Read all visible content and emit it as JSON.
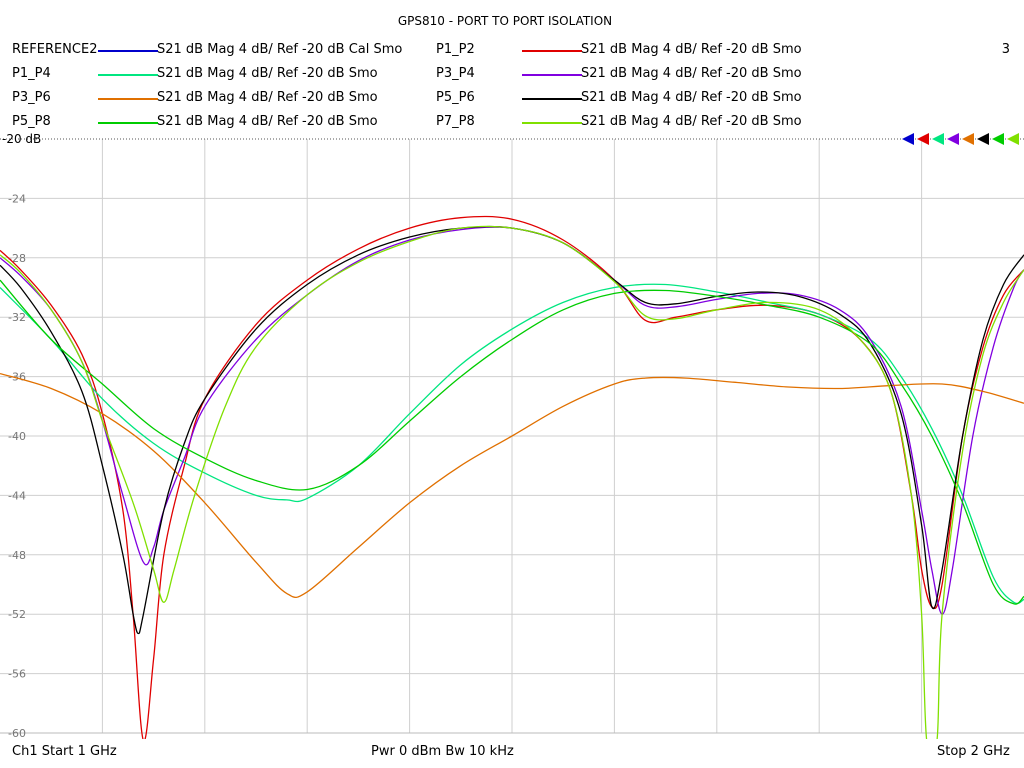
{
  "chart_data": {
    "type": "line",
    "title": "GPS810 - PORT TO PORT ISOLATION",
    "channel_number": "3",
    "reference_label": "-20 dB",
    "yticks": [
      "-24",
      "-28",
      "-32",
      "-36",
      "-40",
      "-44",
      "-48",
      "-52",
      "-56",
      "-60"
    ],
    "xlim": [
      1,
      2
    ],
    "ylim": [
      -60,
      -20
    ],
    "x_divisions": 10,
    "grid": true,
    "legend_position": "top",
    "series": [
      {
        "name": "REFERENCE2",
        "desc": "S21  dB Mag  4 dB/ Ref -20 dB  Cal Smo",
        "color": "#0000cc",
        "points": []
      },
      {
        "name": "P1_P2",
        "desc": "S21  dB Mag  4 dB/ Ref -20 dB  Smo",
        "color": "#e00000",
        "points": [
          [
            1.0,
            -27.5
          ],
          [
            1.02,
            -28.8
          ],
          [
            1.05,
            -31.2
          ],
          [
            1.08,
            -34.5
          ],
          [
            1.1,
            -38.5
          ],
          [
            1.12,
            -45
          ],
          [
            1.13,
            -52
          ],
          [
            1.14,
            -60.5
          ],
          [
            1.15,
            -55
          ],
          [
            1.16,
            -48
          ],
          [
            1.18,
            -42
          ],
          [
            1.2,
            -37.5
          ],
          [
            1.25,
            -32.5
          ],
          [
            1.3,
            -29.5
          ],
          [
            1.35,
            -27.4
          ],
          [
            1.4,
            -26
          ],
          [
            1.45,
            -25.3
          ],
          [
            1.5,
            -25.4
          ],
          [
            1.55,
            -26.8
          ],
          [
            1.6,
            -29.5
          ],
          [
            1.63,
            -32.2
          ],
          [
            1.66,
            -32.0
          ],
          [
            1.7,
            -31.5
          ],
          [
            1.75,
            -31.2
          ],
          [
            1.8,
            -31.8
          ],
          [
            1.84,
            -33.5
          ],
          [
            1.87,
            -37
          ],
          [
            1.89,
            -44
          ],
          [
            1.9,
            -49
          ],
          [
            1.91,
            -51.5
          ],
          [
            1.92,
            -50
          ],
          [
            1.94,
            -40
          ],
          [
            1.96,
            -34
          ],
          [
            1.98,
            -30.5
          ],
          [
            2.0,
            -28.8
          ]
        ]
      },
      {
        "name": "P1_P4",
        "desc": "S21  dB Mag  4 dB/ Ref -20 dB  Smo",
        "color": "#00e680",
        "points": [
          [
            1.0,
            -30.0
          ],
          [
            1.05,
            -33.5
          ],
          [
            1.1,
            -37.5
          ],
          [
            1.15,
            -40.5
          ],
          [
            1.2,
            -42.5
          ],
          [
            1.25,
            -44
          ],
          [
            1.28,
            -44.3
          ],
          [
            1.3,
            -44.2
          ],
          [
            1.35,
            -42
          ],
          [
            1.4,
            -38.5
          ],
          [
            1.45,
            -35.2
          ],
          [
            1.5,
            -32.8
          ],
          [
            1.55,
            -31
          ],
          [
            1.6,
            -30
          ],
          [
            1.65,
            -29.8
          ],
          [
            1.7,
            -30.3
          ],
          [
            1.75,
            -31
          ],
          [
            1.8,
            -31.8
          ],
          [
            1.85,
            -33.5
          ],
          [
            1.88,
            -36
          ],
          [
            1.91,
            -39.5
          ],
          [
            1.94,
            -44
          ],
          [
            1.97,
            -49.5
          ],
          [
            1.99,
            -51.2
          ],
          [
            2.0,
            -51.0
          ]
        ]
      },
      {
        "name": "P3_P4",
        "desc": "S21  dB Mag  4 dB/ Ref -20 dB  Smo",
        "color": "#8000e0",
        "points": [
          [
            1.0,
            -28
          ],
          [
            1.02,
            -29.2
          ],
          [
            1.05,
            -31.5
          ],
          [
            1.08,
            -35
          ],
          [
            1.1,
            -39
          ],
          [
            1.12,
            -44
          ],
          [
            1.14,
            -48.5
          ],
          [
            1.15,
            -47.5
          ],
          [
            1.16,
            -45
          ],
          [
            1.18,
            -41.5
          ],
          [
            1.2,
            -38
          ],
          [
            1.25,
            -33.5
          ],
          [
            1.3,
            -30.5
          ],
          [
            1.35,
            -28.2
          ],
          [
            1.4,
            -26.8
          ],
          [
            1.45,
            -26.1
          ],
          [
            1.5,
            -26.0
          ],
          [
            1.55,
            -27
          ],
          [
            1.6,
            -29.5
          ],
          [
            1.63,
            -31.2
          ],
          [
            1.66,
            -31.3
          ],
          [
            1.7,
            -30.8
          ],
          [
            1.74,
            -30.4
          ],
          [
            1.78,
            -30.5
          ],
          [
            1.82,
            -31.5
          ],
          [
            1.85,
            -33.5
          ],
          [
            1.88,
            -38
          ],
          [
            1.9,
            -45
          ],
          [
            1.91,
            -49
          ],
          [
            1.92,
            -52
          ],
          [
            1.93,
            -49
          ],
          [
            1.95,
            -40
          ],
          [
            1.97,
            -34
          ],
          [
            1.99,
            -30
          ],
          [
            2.0,
            -28.8
          ]
        ]
      },
      {
        "name": "P3_P6",
        "desc": "S21  dB Mag  4 dB/ Ref -20 dB  Smo",
        "color": "#e07000",
        "points": [
          [
            1.0,
            -35.8
          ],
          [
            1.05,
            -36.8
          ],
          [
            1.1,
            -38.5
          ],
          [
            1.15,
            -41
          ],
          [
            1.2,
            -44.5
          ],
          [
            1.25,
            -48.5
          ],
          [
            1.28,
            -50.6
          ],
          [
            1.3,
            -50.5
          ],
          [
            1.35,
            -47.5
          ],
          [
            1.4,
            -44.5
          ],
          [
            1.45,
            -42
          ],
          [
            1.5,
            -40
          ],
          [
            1.55,
            -38
          ],
          [
            1.6,
            -36.5
          ],
          [
            1.63,
            -36.1
          ],
          [
            1.67,
            -36.1
          ],
          [
            1.72,
            -36.4
          ],
          [
            1.77,
            -36.7
          ],
          [
            1.82,
            -36.8
          ],
          [
            1.87,
            -36.6
          ],
          [
            1.92,
            -36.5
          ],
          [
            1.96,
            -37
          ],
          [
            2.0,
            -37.8
          ]
        ]
      },
      {
        "name": "P5_P6",
        "desc": "S21  dB Mag  4 dB/ Ref -20 dB  Smo",
        "color": "#000000",
        "points": [
          [
            1.0,
            -28.5
          ],
          [
            1.02,
            -30
          ],
          [
            1.05,
            -33
          ],
          [
            1.08,
            -37
          ],
          [
            1.1,
            -42
          ],
          [
            1.12,
            -48
          ],
          [
            1.13,
            -52
          ],
          [
            1.135,
            -53.3
          ],
          [
            1.14,
            -52
          ],
          [
            1.16,
            -45
          ],
          [
            1.18,
            -40.5
          ],
          [
            1.2,
            -37.5
          ],
          [
            1.25,
            -32.8
          ],
          [
            1.3,
            -29.8
          ],
          [
            1.35,
            -27.8
          ],
          [
            1.4,
            -26.6
          ],
          [
            1.45,
            -26.0
          ],
          [
            1.5,
            -26.0
          ],
          [
            1.55,
            -27
          ],
          [
            1.6,
            -29.5
          ],
          [
            1.63,
            -31.0
          ],
          [
            1.66,
            -31.1
          ],
          [
            1.7,
            -30.6
          ],
          [
            1.74,
            -30.3
          ],
          [
            1.78,
            -30.6
          ],
          [
            1.82,
            -31.8
          ],
          [
            1.85,
            -33.8
          ],
          [
            1.88,
            -38.5
          ],
          [
            1.9,
            -46
          ],
          [
            1.91,
            -51.5
          ],
          [
            1.92,
            -49
          ],
          [
            1.94,
            -40
          ],
          [
            1.96,
            -33.5
          ],
          [
            1.98,
            -29.8
          ],
          [
            2.0,
            -27.8
          ]
        ]
      },
      {
        "name": "P5_P8",
        "desc": "S21  dB Mag  4 dB/ Ref -20 dB  Smo",
        "color": "#00cc00",
        "points": [
          [
            1.0,
            -29.5
          ],
          [
            1.05,
            -33.5
          ],
          [
            1.1,
            -36.5
          ],
          [
            1.15,
            -39.5
          ],
          [
            1.2,
            -41.5
          ],
          [
            1.25,
            -43
          ],
          [
            1.3,
            -43.6
          ],
          [
            1.35,
            -42
          ],
          [
            1.4,
            -39
          ],
          [
            1.45,
            -36
          ],
          [
            1.5,
            -33.5
          ],
          [
            1.55,
            -31.5
          ],
          [
            1.6,
            -30.4
          ],
          [
            1.65,
            -30.2
          ],
          [
            1.7,
            -30.6
          ],
          [
            1.75,
            -31.2
          ],
          [
            1.8,
            -32
          ],
          [
            1.85,
            -33.8
          ],
          [
            1.88,
            -36.5
          ],
          [
            1.91,
            -40
          ],
          [
            1.94,
            -44.5
          ],
          [
            1.97,
            -50
          ],
          [
            1.99,
            -51.3
          ],
          [
            2.0,
            -50.8
          ]
        ]
      },
      {
        "name": "P7_P8",
        "desc": "S21  dB Mag  4 dB/ Ref -20 dB  Smo",
        "color": "#80e000",
        "points": [
          [
            1.0,
            -27.8
          ],
          [
            1.02,
            -29
          ],
          [
            1.05,
            -31.5
          ],
          [
            1.08,
            -35
          ],
          [
            1.1,
            -39
          ],
          [
            1.13,
            -44.5
          ],
          [
            1.15,
            -49
          ],
          [
            1.16,
            -51.2
          ],
          [
            1.17,
            -49
          ],
          [
            1.19,
            -44
          ],
          [
            1.22,
            -38
          ],
          [
            1.25,
            -34
          ],
          [
            1.3,
            -30.5
          ],
          [
            1.35,
            -28.3
          ],
          [
            1.4,
            -26.9
          ],
          [
            1.45,
            -26.0
          ],
          [
            1.5,
            -26.0
          ],
          [
            1.55,
            -27
          ],
          [
            1.6,
            -29.6
          ],
          [
            1.63,
            -31.9
          ],
          [
            1.66,
            -32.1
          ],
          [
            1.7,
            -31.5
          ],
          [
            1.75,
            -31.0
          ],
          [
            1.8,
            -31.5
          ],
          [
            1.84,
            -33.5
          ],
          [
            1.87,
            -37
          ],
          [
            1.89,
            -44
          ],
          [
            1.9,
            -52
          ],
          [
            1.905,
            -60.5
          ],
          [
            1.915,
            -60.5
          ],
          [
            1.92,
            -52
          ],
          [
            1.94,
            -41
          ],
          [
            1.96,
            -34.5
          ],
          [
            1.98,
            -31
          ],
          [
            2.0,
            -28.8
          ]
        ]
      }
    ]
  },
  "footer": {
    "left": "Ch1  Start  1 GHz",
    "center": "Pwr  0 dBm  Bw  10 kHz",
    "right": "Stop  2 GHz"
  }
}
